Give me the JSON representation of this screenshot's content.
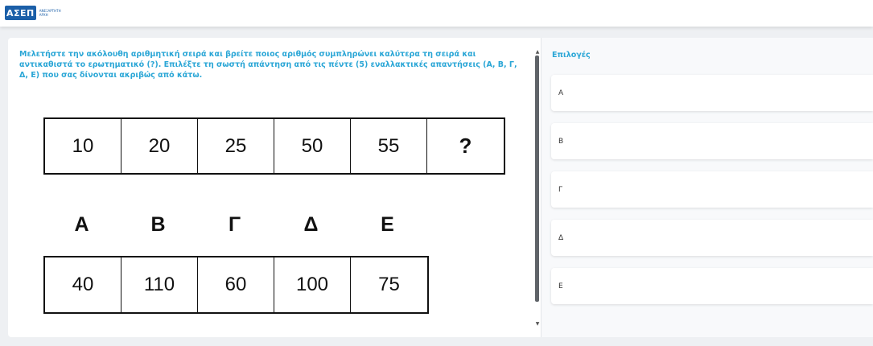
{
  "header": {
    "logo_mark": "ΑΣΕΠ",
    "logo_line1": "ΑΝΕΞΑΡΤΗΤΗ",
    "logo_line2": "ΑΡΧΗ"
  },
  "question": {
    "text": "Μελετήστε την ακόλουθη αριθμητική σειρά και βρείτε ποιος αριθμός συμπληρώνει καλύτερα τη σειρά και αντικαθιστά το ερωτηματικό (?). Επιλέξτε τη σωστή απάντηση από τις πέντε (5) εναλλακτικές απαντήσεις (Α, Β, Γ, Δ, Ε) που σας δίνονται ακριβώς από κάτω.",
    "sequence": [
      "10",
      "20",
      "25",
      "50",
      "55",
      "?"
    ],
    "answer_letters": [
      "Α",
      "Β",
      "Γ",
      "Δ",
      "Ε"
    ],
    "answer_values": [
      "40",
      "110",
      "60",
      "100",
      "75"
    ]
  },
  "scrollbar": {
    "up_arrow": "▲",
    "down_arrow": "▼"
  },
  "options": {
    "heading": "Επιλογές",
    "items": [
      "Α",
      "Β",
      "Γ",
      "Δ",
      "Ε"
    ]
  },
  "colors": {
    "accent": "#2aa6d6",
    "brand": "#1b5fa8",
    "background": "#eef0f3"
  }
}
